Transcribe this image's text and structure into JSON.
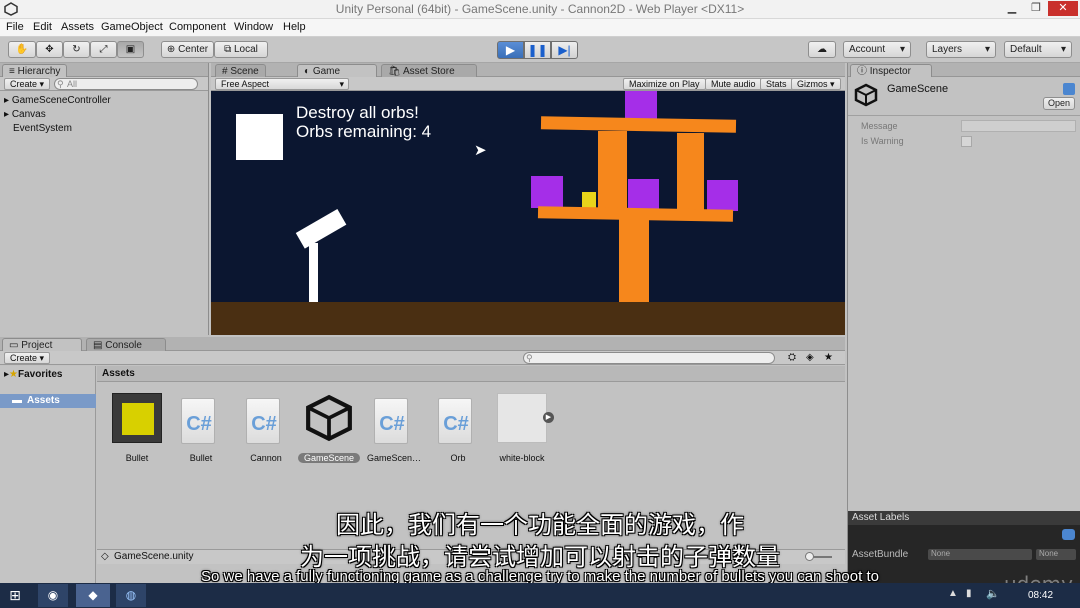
{
  "window": {
    "title": "Unity Personal (64bit) - GameScene.unity - Cannon2D - Web Player <DX11>"
  },
  "menu": [
    "File",
    "Edit",
    "Assets",
    "GameObject",
    "Component",
    "Window",
    "Help"
  ],
  "toolbar": {
    "center_label": "Center",
    "local_label": "Local",
    "account_label": "Account",
    "layers_label": "Layers",
    "layout_label": "Default"
  },
  "hierarchy": {
    "tab": "Hierarchy",
    "create_label": "Create",
    "search_placeholder": "All",
    "items": [
      "GameSceneController",
      "Canvas",
      "EventSystem"
    ]
  },
  "scene_tabs": {
    "scene": "Scene",
    "game": "Game",
    "asset_store": "Asset Store"
  },
  "game_bar": {
    "aspect": "Free Aspect",
    "maximize": "Maximize on Play",
    "mute": "Mute audio",
    "stats": "Stats",
    "gizmos": "Gizmos"
  },
  "game": {
    "line1": "Destroy all orbs!",
    "line2": "Orbs remaining: 4"
  },
  "inspector": {
    "tab": "Inspector",
    "object_name": "GameScene",
    "open_label": "Open",
    "message_label": "Message",
    "warning_label": "Is Warning",
    "asset_labels": "Asset Labels",
    "asset_bundle": "AssetBundle",
    "bundle_value": "None",
    "bundle_variant": "None"
  },
  "project": {
    "tab": "Project",
    "console_tab": "Console",
    "create_label": "Create",
    "favorites": "Favorites",
    "assets_folder": "Assets",
    "assets_header": "Assets",
    "footer_file": "GameScene.unity",
    "items": [
      {
        "name": "Bullet",
        "kind": "prefab"
      },
      {
        "name": "Bullet",
        "kind": "script"
      },
      {
        "name": "Cannon",
        "kind": "script"
      },
      {
        "name": "GameScene",
        "kind": "unity"
      },
      {
        "name": "GameScen…",
        "kind": "script"
      },
      {
        "name": "Orb",
        "kind": "script"
      },
      {
        "name": "white-block",
        "kind": "sprite"
      }
    ]
  },
  "subtitles": {
    "cn_line1": "因此，我们有一个功能全面的游戏，作",
    "cn_line2": "为一项挑战，请尝试增加可以射击的子弹数量",
    "en_line": "So we have a fully functioning game as a challenge try to make the number of bullets you can shoot to"
  },
  "watermark": "udemy",
  "taskbar": {
    "clock": "08:42"
  },
  "colors": {
    "game_bg": "#0b1630",
    "orange": "#f6871c",
    "purple": "#a52ee8",
    "ground": "#4a2f12",
    "play_blue": "#3a6fb8"
  }
}
